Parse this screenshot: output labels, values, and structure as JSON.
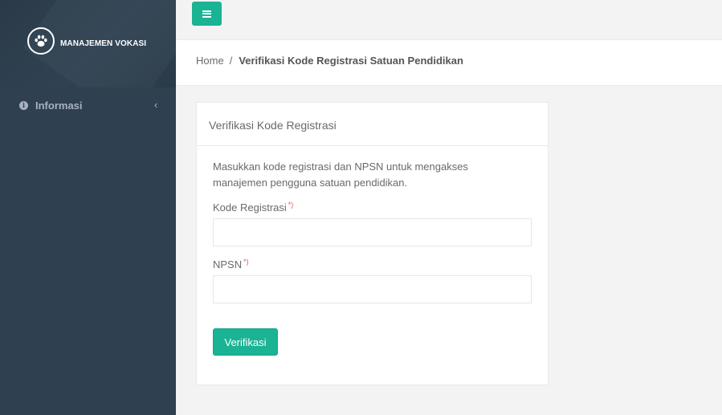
{
  "brand": {
    "name": "MANAJEMEN VOKASI",
    "logo_icon": "paw-icon"
  },
  "sidebar": {
    "items": [
      {
        "label": "Informasi",
        "icon": "info-circle-icon",
        "chevron": "‹"
      }
    ]
  },
  "topbar": {
    "menu_icon": "hamburger-icon",
    "accent_color": "#1ab394"
  },
  "breadcrumb": {
    "home": "Home",
    "separator": "/",
    "current": "Verifikasi Kode Registrasi Satuan Pendidikan"
  },
  "card": {
    "title": "Verifikasi Kode Registrasi",
    "description": "Masukkan kode registrasi dan NPSN untuk mengakses manajemen pengguna satuan pendidikan.",
    "fields": [
      {
        "label": "Kode Registrasi",
        "required_mark": "*)",
        "value": "",
        "placeholder": ""
      },
      {
        "label": "NPSN",
        "required_mark": "*)",
        "value": "",
        "placeholder": ""
      }
    ],
    "submit_label": "Verifikasi"
  }
}
